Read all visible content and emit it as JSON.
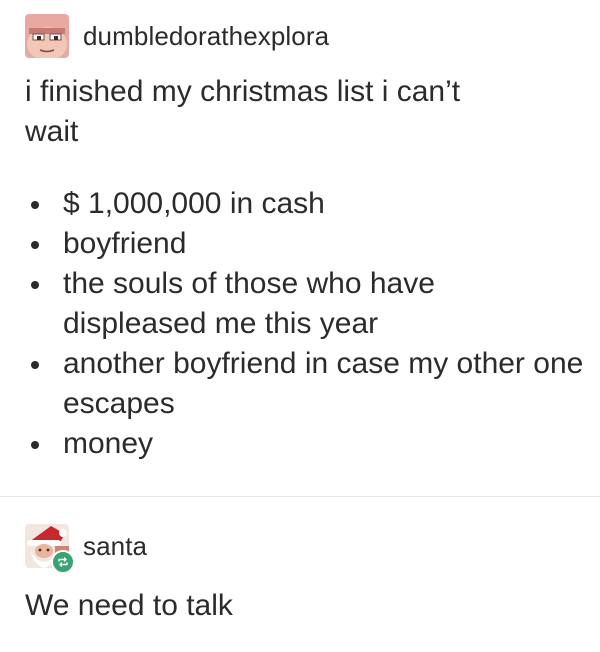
{
  "colors": {
    "text": "#2b2b2b",
    "divider": "#e6e6e6",
    "reblog_green": "#3aa376"
  },
  "post": {
    "author": {
      "username": "dumbledorathexplora",
      "avatar_icon": "cartoon-face-avatar-icon"
    },
    "text_line1": "i finished my christmas list i can’t",
    "text_line2": "wait",
    "list": [
      "$ 1,000,000 in cash",
      "boyfriend",
      "the souls of those who have displeased me this year",
      "another boyfriend in case my other one escapes",
      "money"
    ]
  },
  "reply": {
    "author": {
      "username": "santa",
      "avatar_icon": "santa-avatar-icon",
      "badge_icon": "reblog-icon"
    },
    "text": "We need to talk"
  }
}
